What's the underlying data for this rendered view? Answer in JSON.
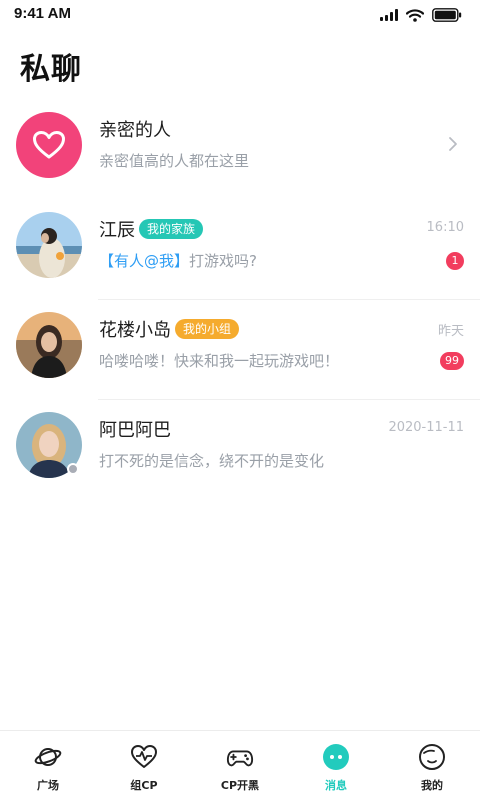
{
  "status_bar": {
    "time": "9:41 AM"
  },
  "page": {
    "title": "私聊"
  },
  "intimate": {
    "title": "亲密的人",
    "subtitle": "亲密值高的人都在这里"
  },
  "conversations": [
    {
      "name": "江辰",
      "tag": "我的家族",
      "time": "16:10",
      "mention": "【有人@我】",
      "message": "打游戏吗?",
      "unread": "1"
    },
    {
      "name": "花楼小岛",
      "tag": "我的小组",
      "time": "昨天",
      "message": "哈喽哈喽！快来和我一起玩游戏吧！",
      "unread": "99"
    },
    {
      "name": "阿巴阿巴",
      "time": "2020-11-11",
      "message": "打不死的是信念，绕不开的是变化"
    }
  ],
  "tab_bar": {
    "items": [
      {
        "label": "广场",
        "icon": "planet-icon"
      },
      {
        "label": "组CP",
        "icon": "heartbeat-icon"
      },
      {
        "label": "CP开黑",
        "icon": "gamepad-icon"
      },
      {
        "label": "消息",
        "icon": "chat-bubble-icon",
        "active": true
      },
      {
        "label": "我的",
        "icon": "smiley-face-icon"
      }
    ]
  },
  "colors": {
    "accent": "#22cbbd",
    "heart_pink": "#f2437a",
    "badge_red": "#f23d5e",
    "tag_teal": "#25c7b5",
    "tag_orange": "#f5ab2e",
    "mention_blue": "#2f9ef4"
  }
}
